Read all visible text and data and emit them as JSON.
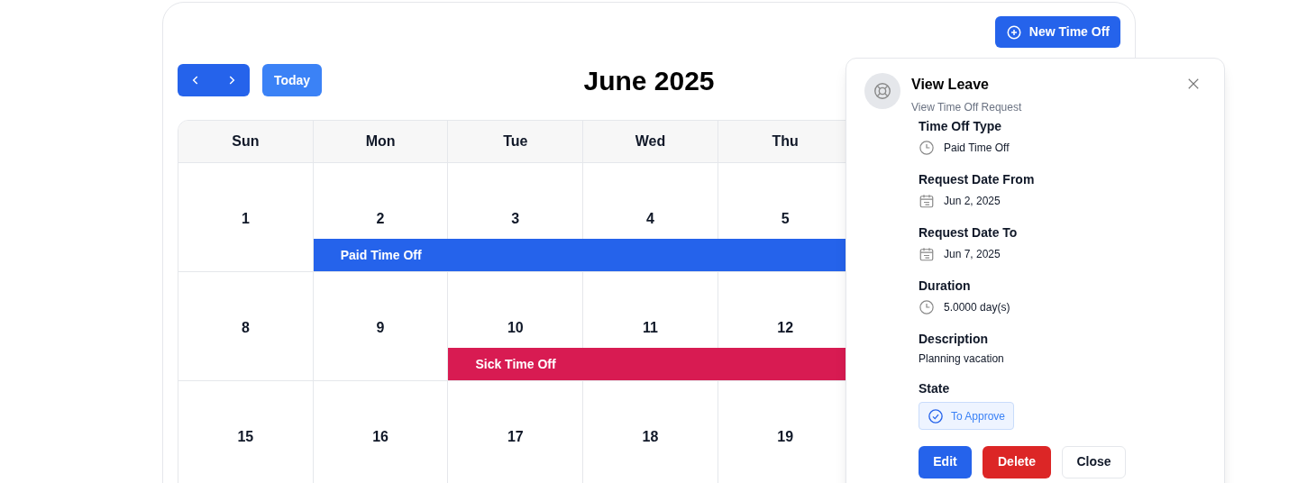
{
  "toolbar": {
    "new_button": "New Time Off",
    "today_button": "Today",
    "title": "June 2025"
  },
  "calendar": {
    "columns": [
      "Sun",
      "Mon",
      "Tue",
      "Wed",
      "Thu"
    ],
    "weeks": [
      {
        "days": [
          {
            "day": "1"
          },
          {
            "day": "2",
            "event": {
              "label": "Paid Time Off",
              "color": "#2563eb"
            }
          },
          {
            "day": "3"
          },
          {
            "day": "4"
          },
          {
            "day": "5"
          }
        ]
      },
      {
        "days": [
          {
            "day": "8"
          },
          {
            "day": "9"
          },
          {
            "day": "10",
            "event": {
              "label": "Sick Time Off",
              "color": "#d81b52"
            }
          },
          {
            "day": "11"
          },
          {
            "day": "12"
          }
        ]
      },
      {
        "days": [
          {
            "day": "15"
          },
          {
            "day": "16"
          },
          {
            "day": "17"
          },
          {
            "day": "18"
          },
          {
            "day": "19"
          }
        ]
      }
    ]
  },
  "popover": {
    "title": "View Leave",
    "subtitle": "View Time Off Request",
    "fields": [
      {
        "label": "Time Off Type",
        "value": "Paid Time Off",
        "kind": "clock"
      },
      {
        "label": "Request Date From",
        "value": "Jun 2, 2025",
        "kind": "date"
      },
      {
        "label": "Request Date To",
        "value": "Jun 7, 2025",
        "kind": "date"
      },
      {
        "label": "Duration",
        "value": "5.0000 day(s)",
        "kind": "clock"
      },
      {
        "label": "Description",
        "value": "Planning vacation",
        "kind": "text"
      },
      {
        "label": "State",
        "value": "To Approve",
        "kind": "badge"
      }
    ],
    "buttons": [
      {
        "label": "Edit",
        "kind": "primary"
      },
      {
        "label": "Delete",
        "kind": "danger"
      },
      {
        "label": "Close",
        "kind": "outline"
      }
    ]
  }
}
